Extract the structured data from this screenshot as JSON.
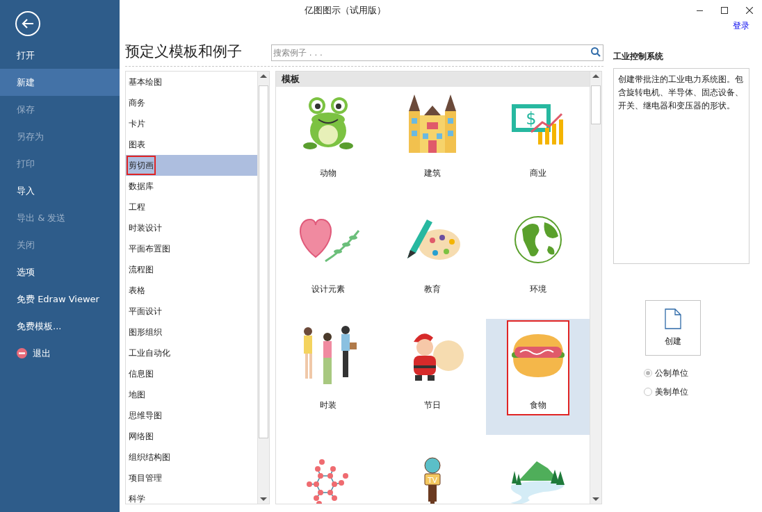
{
  "window": {
    "title": "亿图图示（试用版）",
    "login": "登录"
  },
  "sidebar": {
    "items": [
      {
        "label": "打开",
        "selected": false,
        "disabled": false,
        "kind": "text"
      },
      {
        "label": "新建",
        "selected": true,
        "disabled": false,
        "kind": "text"
      },
      {
        "label": "保存",
        "selected": false,
        "disabled": true,
        "kind": "text"
      },
      {
        "label": "另存为",
        "selected": false,
        "disabled": true,
        "kind": "text"
      },
      {
        "label": "打印",
        "selected": false,
        "disabled": true,
        "kind": "text"
      },
      {
        "label": "导入",
        "selected": false,
        "disabled": false,
        "kind": "text"
      },
      {
        "label": "导出 & 发送",
        "selected": false,
        "disabled": true,
        "kind": "text"
      },
      {
        "label": "关闭",
        "selected": false,
        "disabled": true,
        "kind": "text"
      },
      {
        "label": "选项",
        "selected": false,
        "disabled": false,
        "kind": "text"
      },
      {
        "label": "免费 Edraw Viewer",
        "selected": false,
        "disabled": false,
        "kind": "text"
      },
      {
        "label": "免费模板...",
        "selected": false,
        "disabled": false,
        "kind": "text"
      },
      {
        "label": "退出",
        "selected": false,
        "disabled": false,
        "kind": "exit"
      }
    ]
  },
  "heading": "预定义模板和例子",
  "search": {
    "placeholder": "搜索例子 . . ."
  },
  "categories": [
    {
      "label": "基本绘图",
      "selected": false,
      "marked": false
    },
    {
      "label": "商务",
      "selected": false,
      "marked": false
    },
    {
      "label": "卡片",
      "selected": false,
      "marked": false
    },
    {
      "label": "图表",
      "selected": false,
      "marked": false
    },
    {
      "label": "剪切画",
      "selected": true,
      "marked": true
    },
    {
      "label": "数据库",
      "selected": false,
      "marked": false
    },
    {
      "label": "工程",
      "selected": false,
      "marked": false
    },
    {
      "label": "时装设计",
      "selected": false,
      "marked": false
    },
    {
      "label": "平面布置图",
      "selected": false,
      "marked": false
    },
    {
      "label": "流程图",
      "selected": false,
      "marked": false
    },
    {
      "label": "表格",
      "selected": false,
      "marked": false
    },
    {
      "label": "平面设计",
      "selected": false,
      "marked": false
    },
    {
      "label": "图形组织",
      "selected": false,
      "marked": false
    },
    {
      "label": "工业自动化",
      "selected": false,
      "marked": false
    },
    {
      "label": "信息图",
      "selected": false,
      "marked": false
    },
    {
      "label": "地图",
      "selected": false,
      "marked": false
    },
    {
      "label": "思维导图",
      "selected": false,
      "marked": false
    },
    {
      "label": "网络图",
      "selected": false,
      "marked": false
    },
    {
      "label": "组织结构图",
      "selected": false,
      "marked": false
    },
    {
      "label": "项目管理",
      "selected": false,
      "marked": false
    },
    {
      "label": "科学",
      "selected": false,
      "marked": false
    }
  ],
  "templates": {
    "header": "模板",
    "items": [
      {
        "label": "动物",
        "kind": "frog",
        "selected": false,
        "marked": false
      },
      {
        "label": "建筑",
        "kind": "building",
        "selected": false,
        "marked": false
      },
      {
        "label": "商业",
        "kind": "money",
        "art_text": "$",
        "selected": false,
        "marked": false
      },
      {
        "label": "设计元素",
        "kind": "heart",
        "selected": false,
        "marked": false
      },
      {
        "label": "教育",
        "kind": "palette",
        "selected": false,
        "marked": false
      },
      {
        "label": "环境",
        "kind": "globe",
        "selected": false,
        "marked": false
      },
      {
        "label": "时装",
        "kind": "people",
        "selected": false,
        "marked": false
      },
      {
        "label": "节日",
        "kind": "santa",
        "selected": false,
        "marked": false
      },
      {
        "label": "食物",
        "kind": "hotdog",
        "selected": true,
        "marked": true
      },
      {
        "kind": "network",
        "selected": false,
        "marked": false
      },
      {
        "kind": "microphone",
        "art_text": "TV",
        "selected": false,
        "marked": false
      },
      {
        "kind": "mountain",
        "selected": false,
        "marked": false
      }
    ]
  },
  "details": {
    "title": "工业控制系统",
    "description": "创建带批注的工业电力系统图。包含旋转电机、半导体、固态设备、开关、继电器和变压器的形状。"
  },
  "create_button": "创建",
  "units": [
    {
      "label": "公制单位",
      "selected": true
    },
    {
      "label": "美制单位",
      "selected": false
    }
  ]
}
